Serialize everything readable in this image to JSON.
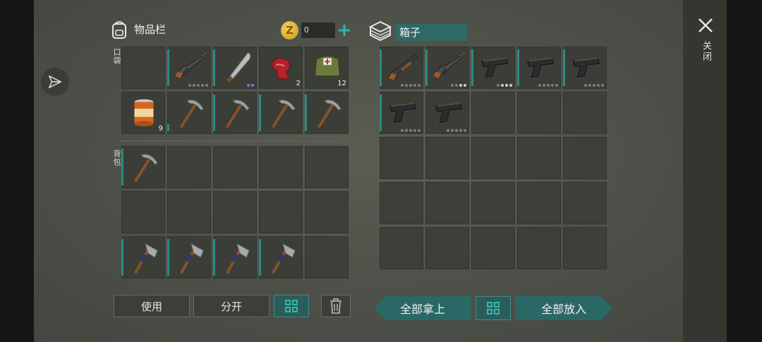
{
  "close_label": "关闭",
  "inventory": {
    "title": "物品栏",
    "coins": "0",
    "pockets_label": "口袋",
    "backpack_label": "背包",
    "pockets": [
      {
        "item": "empty"
      },
      {
        "item": "rifle",
        "bar": "full",
        "dots": [
          "off",
          "off",
          "off",
          "off",
          "off"
        ]
      },
      {
        "item": "machete",
        "bar": "full",
        "dots": [
          "purple",
          "purple"
        ]
      },
      {
        "item": "raw-meat",
        "count": "2"
      },
      {
        "item": "first-aid-bag",
        "count": "12"
      },
      {
        "item": "canned-food",
        "count": "9"
      },
      {
        "item": "pickaxe",
        "bar": "short"
      },
      {
        "item": "pickaxe",
        "bar": "full"
      },
      {
        "item": "pickaxe",
        "bar": "full"
      },
      {
        "item": "pickaxe",
        "bar": "full"
      }
    ],
    "backpack": [
      {
        "item": "pickaxe",
        "bar": "full"
      },
      {
        "item": "empty"
      },
      {
        "item": "empty"
      },
      {
        "item": "empty"
      },
      {
        "item": "empty"
      },
      {
        "item": "empty"
      },
      {
        "item": "empty"
      },
      {
        "item": "empty"
      },
      {
        "item": "empty"
      },
      {
        "item": "empty"
      },
      {
        "item": "hatchet",
        "bar": "full"
      },
      {
        "item": "hatchet",
        "bar": "full"
      },
      {
        "item": "hatchet",
        "bar": "full"
      },
      {
        "item": "hatchet",
        "bar": "full"
      },
      {
        "item": "empty"
      }
    ],
    "buttons": {
      "use": "使用",
      "split": "分开"
    }
  },
  "box": {
    "title": "箱子",
    "slots": [
      {
        "item": "shotgun",
        "bar": "full",
        "dots": [
          "off",
          "off",
          "off",
          "off",
          "off"
        ]
      },
      {
        "item": "rifle",
        "bar": "full",
        "dots": [
          "off",
          "off",
          "on",
          "on"
        ]
      },
      {
        "item": "pistol",
        "bar": "full",
        "dots": [
          "off",
          "on",
          "on",
          "on"
        ]
      },
      {
        "item": "pistol",
        "bar": "full",
        "dots": [
          "off",
          "off",
          "off",
          "off",
          "off"
        ]
      },
      {
        "item": "pistol",
        "bar": "full",
        "dots": [
          "off",
          "off",
          "off",
          "off",
          "off"
        ]
      },
      {
        "item": "pistol",
        "bar": "full",
        "dots": [
          "off",
          "off",
          "off",
          "off",
          "off"
        ]
      },
      {
        "item": "pistol",
        "dots": [
          "off",
          "off",
          "off",
          "off",
          "off"
        ]
      }
    ],
    "buttons": {
      "take_all": "全部拿上",
      "put_all": "全部放入"
    }
  }
}
